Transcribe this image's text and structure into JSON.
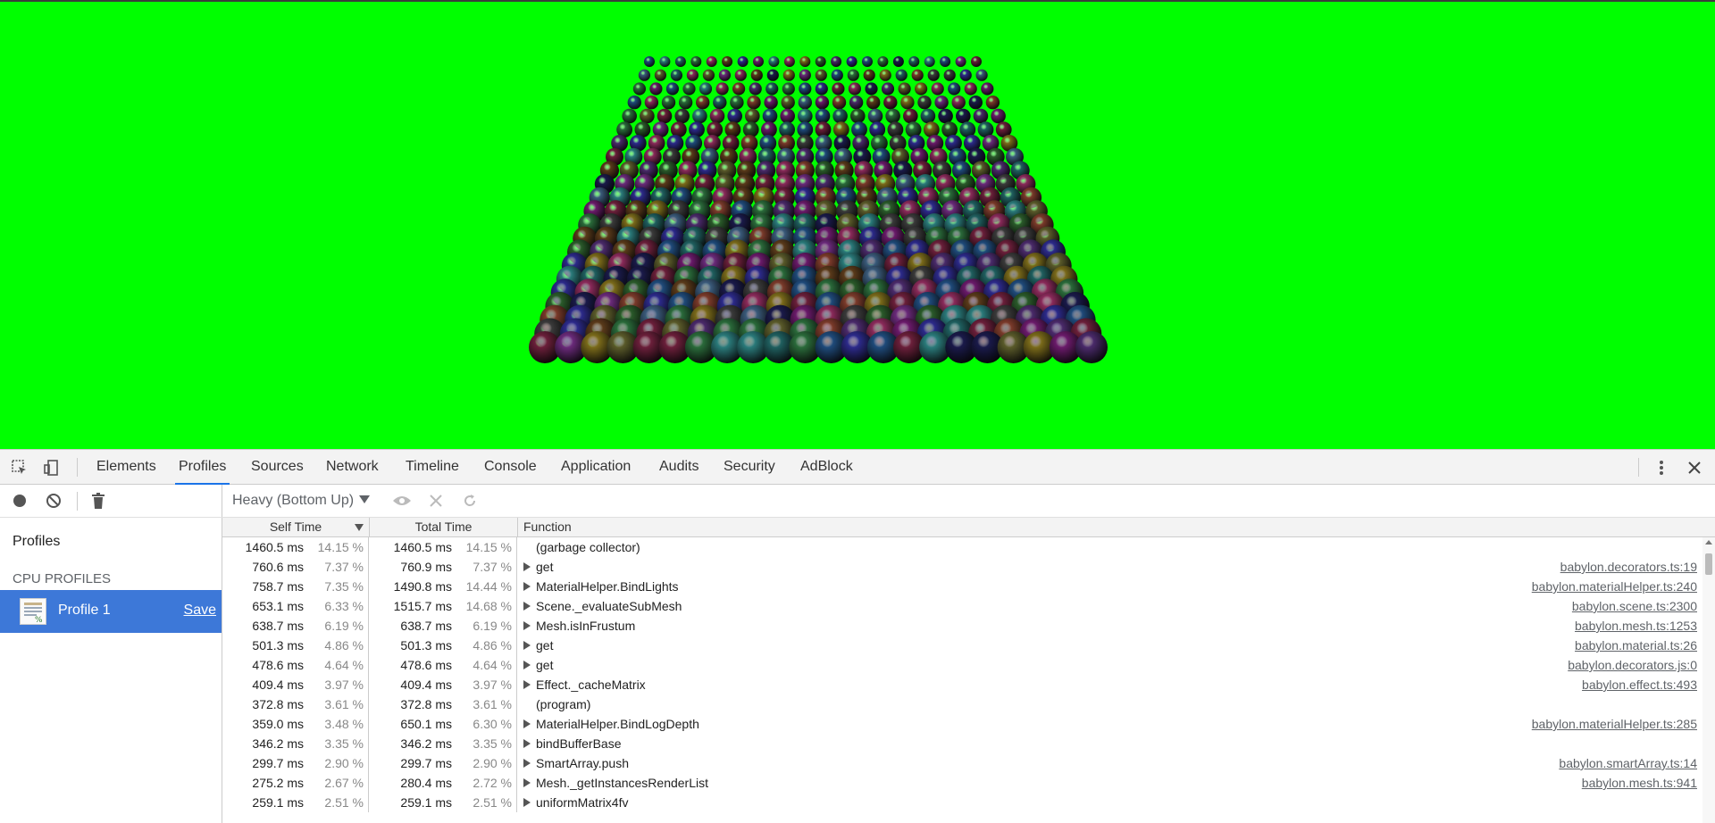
{
  "devtools": {
    "tabs": [
      "Elements",
      "Profiles",
      "Sources",
      "Network",
      "Timeline",
      "Console",
      "Application",
      "Audits",
      "Security",
      "AdBlock"
    ],
    "active_tab": "Profiles"
  },
  "sidebar": {
    "title": "Profiles",
    "section": "CPU PROFILES",
    "profile_name": "Profile 1",
    "save_label": "Save"
  },
  "profile_view": {
    "view_mode": "Heavy (Bottom Up)",
    "columns": {
      "self": "Self Time",
      "total": "Total Time",
      "function": "Function"
    },
    "rows": [
      {
        "self_ms": "1460.5 ms",
        "self_pct": "14.15 %",
        "total_ms": "1460.5 ms",
        "total_pct": "14.15 %",
        "func": "(garbage collector)",
        "expandable": false,
        "url": ""
      },
      {
        "self_ms": "760.6 ms",
        "self_pct": "7.37 %",
        "total_ms": "760.9 ms",
        "total_pct": "7.37 %",
        "func": "get",
        "expandable": true,
        "url": "babylon.decorators.ts:19"
      },
      {
        "self_ms": "758.7 ms",
        "self_pct": "7.35 %",
        "total_ms": "1490.8 ms",
        "total_pct": "14.44 %",
        "func": "MaterialHelper.BindLights",
        "expandable": true,
        "url": "babylon.materialHelper.ts:240"
      },
      {
        "self_ms": "653.1 ms",
        "self_pct": "6.33 %",
        "total_ms": "1515.7 ms",
        "total_pct": "14.68 %",
        "func": "Scene._evaluateSubMesh",
        "expandable": true,
        "url": "babylon.scene.ts:2300"
      },
      {
        "self_ms": "638.7 ms",
        "self_pct": "6.19 %",
        "total_ms": "638.7 ms",
        "total_pct": "6.19 %",
        "func": "Mesh.isInFrustum",
        "expandable": true,
        "url": "babylon.mesh.ts:1253"
      },
      {
        "self_ms": "501.3 ms",
        "self_pct": "4.86 %",
        "total_ms": "501.3 ms",
        "total_pct": "4.86 %",
        "func": "get",
        "expandable": true,
        "url": "babylon.material.ts:26"
      },
      {
        "self_ms": "478.6 ms",
        "self_pct": "4.64 %",
        "total_ms": "478.6 ms",
        "total_pct": "4.64 %",
        "func": "get",
        "expandable": true,
        "url": "babylon.decorators.js:0"
      },
      {
        "self_ms": "409.4 ms",
        "self_pct": "3.97 %",
        "total_ms": "409.4 ms",
        "total_pct": "3.97 %",
        "func": "Effect._cacheMatrix",
        "expandable": true,
        "url": "babylon.effect.ts:493"
      },
      {
        "self_ms": "372.8 ms",
        "self_pct": "3.61 %",
        "total_ms": "372.8 ms",
        "total_pct": "3.61 %",
        "func": "(program)",
        "expandable": false,
        "url": ""
      },
      {
        "self_ms": "359.0 ms",
        "self_pct": "3.48 %",
        "total_ms": "650.1 ms",
        "total_pct": "6.30 %",
        "func": "MaterialHelper.BindLogDepth",
        "expandable": true,
        "url": "babylon.materialHelper.ts:285"
      },
      {
        "self_ms": "346.2 ms",
        "self_pct": "3.35 %",
        "total_ms": "346.2 ms",
        "total_pct": "3.35 %",
        "func": "bindBufferBase",
        "expandable": true,
        "url": ""
      },
      {
        "self_ms": "299.7 ms",
        "self_pct": "2.90 %",
        "total_ms": "299.7 ms",
        "total_pct": "2.90 %",
        "func": "SmartArray.push",
        "expandable": true,
        "url": "babylon.smartArray.ts:14"
      },
      {
        "self_ms": "275.2 ms",
        "self_pct": "2.67 %",
        "total_ms": "280.4 ms",
        "total_pct": "2.72 %",
        "func": "Mesh._getInstancesRenderList",
        "expandable": true,
        "url": "babylon.mesh.ts:941"
      },
      {
        "self_ms": "259.1 ms",
        "self_pct": "2.51 %",
        "total_ms": "259.1 ms",
        "total_pct": "2.51 %",
        "func": "uniformMatrix4fv",
        "expandable": true,
        "url": ""
      }
    ]
  },
  "colors": {
    "canvas_bg": "#00ff00",
    "selected_item": "#3d78d8",
    "active_tab_underline": "#1a73e8"
  }
}
